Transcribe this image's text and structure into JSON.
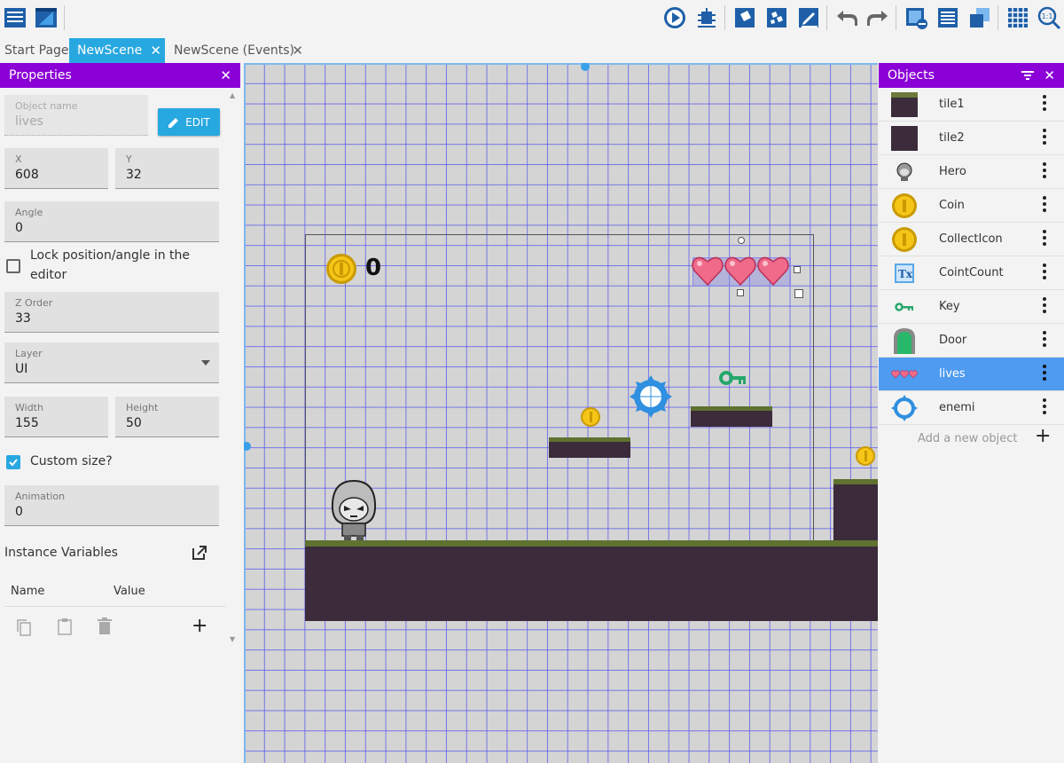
{
  "toolbar": {
    "icons": [
      "project-manager-icon",
      "scene-icon",
      "play-icon",
      "debugger-icon",
      "objects-editor-icon",
      "object-groups-icon",
      "scene-properties-icon",
      "undo-icon",
      "redo-icon",
      "layers-icon",
      "instances-list-icon",
      "object-instances-icon",
      "grid-icon",
      "zoom-icon"
    ]
  },
  "tabs": [
    {
      "label": "Start Page",
      "active": false,
      "closable": false
    },
    {
      "label": "NewScene",
      "active": true,
      "closable": true
    },
    {
      "label": "NewScene (Events)",
      "active": false,
      "closable": true
    }
  ],
  "properties": {
    "title": "Properties",
    "object_name_label": "Object name",
    "object_name_value": "lives",
    "edit_label": "EDIT",
    "x_label": "X",
    "x_value": "608",
    "y_label": "Y",
    "y_value": "32",
    "angle_label": "Angle",
    "angle_value": "0",
    "lock_label": "Lock position/angle in the editor",
    "lock_checked": false,
    "zorder_label": "Z Order",
    "zorder_value": "33",
    "layer_label": "Layer",
    "layer_value": "UI",
    "width_label": "Width",
    "width_value": "155",
    "height_label": "Height",
    "height_value": "50",
    "custom_size_label": "Custom size?",
    "custom_size_checked": true,
    "animation_label": "Animation",
    "animation_value": "0",
    "instance_vars_label": "Instance Variables",
    "col_name": "Name",
    "col_value": "Value"
  },
  "scene": {
    "coin_count_text": "0"
  },
  "objects": {
    "title": "Objects",
    "items": [
      {
        "name": "tile1",
        "thumb": "tile1"
      },
      {
        "name": "tile2",
        "thumb": "tile2"
      },
      {
        "name": "Hero",
        "thumb": "hero"
      },
      {
        "name": "Coin",
        "thumb": "coin"
      },
      {
        "name": "CollectIcon",
        "thumb": "coin"
      },
      {
        "name": "CointCount",
        "thumb": "text"
      },
      {
        "name": "Key",
        "thumb": "key"
      },
      {
        "name": "Door",
        "thumb": "door"
      },
      {
        "name": "lives",
        "thumb": "hearts",
        "selected": true
      },
      {
        "name": "enemi",
        "thumb": "enemy"
      }
    ],
    "add_label": "Add a new object"
  },
  "colors": {
    "accent": "#28a8e0",
    "panel_header": "#8b00d6",
    "selected_row": "#4e9bf0",
    "grid_line": "#5555f0",
    "canvas_bg": "#d4d4d4"
  }
}
